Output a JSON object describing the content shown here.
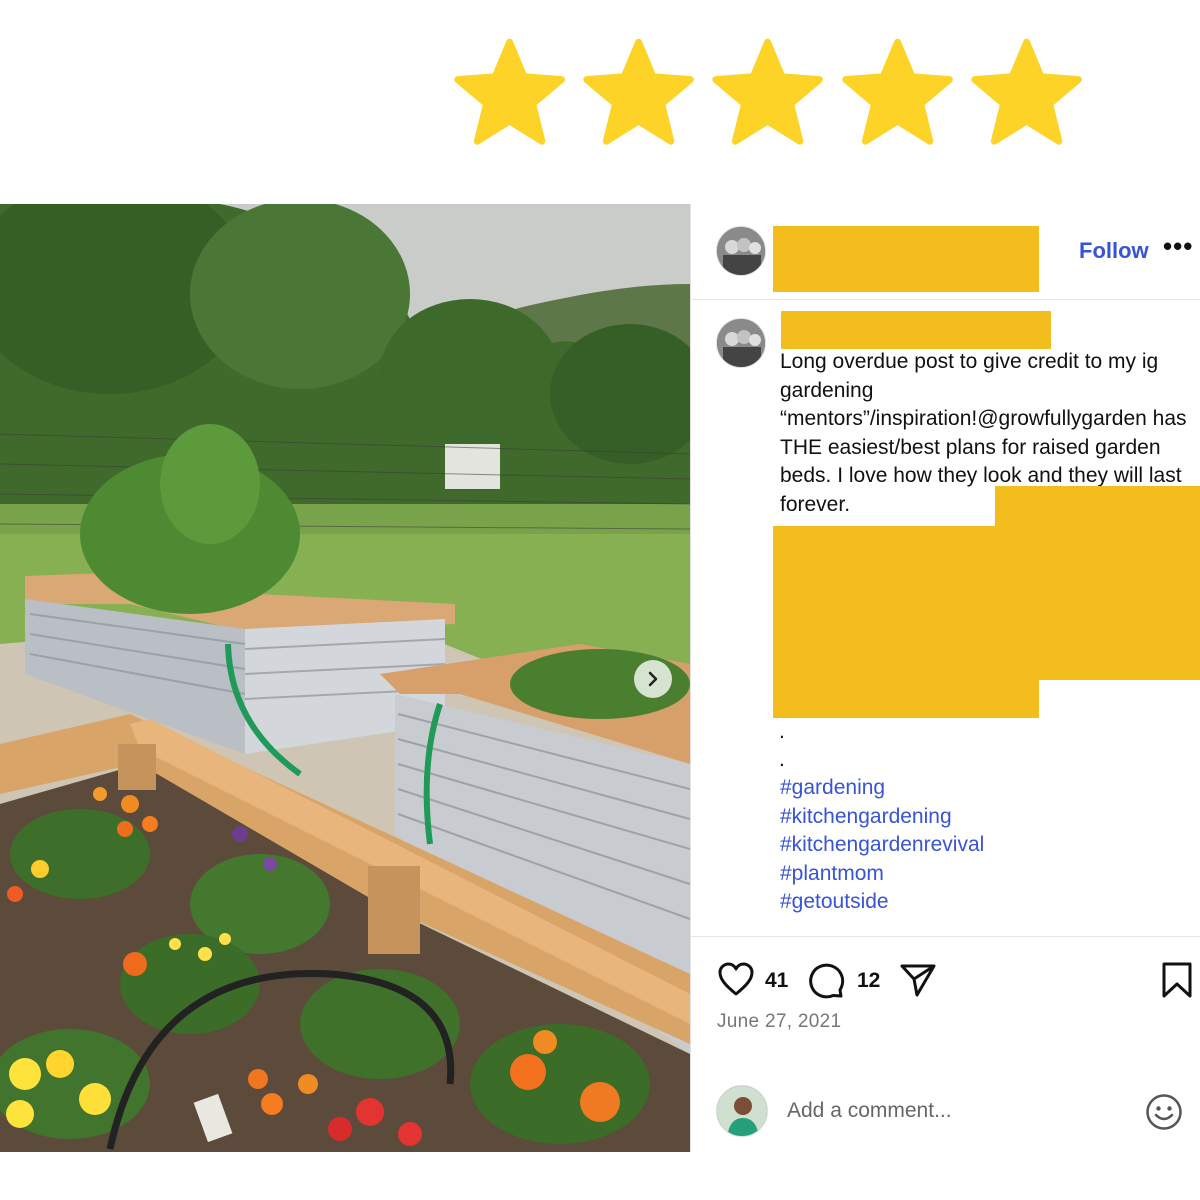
{
  "rating": {
    "value": 5,
    "max": 5,
    "color": "#fdd328"
  },
  "post": {
    "header": {
      "follow_label": "Follow",
      "more_label": "•••"
    },
    "caption": {
      "text": "Long overdue post to give credit to my ig gardening “mentors”/inspiration!@growfullygarden has THE easiest/best plans for raised garden beds. I love how they look and they will last forever.",
      "dot_1": ".",
      "dot_2": "."
    },
    "hashtags": [
      "#gardening",
      "#kitchengardening",
      "#kitchengardenrevival",
      "#plantmom",
      "#getoutside"
    ],
    "likes": "41",
    "comments": "12",
    "date": "June 27, 2021",
    "comment_placeholder": "Add a comment..."
  },
  "colors": {
    "link": "#3753d6",
    "redaction": "#f3bd1e",
    "muted": "#777777"
  }
}
